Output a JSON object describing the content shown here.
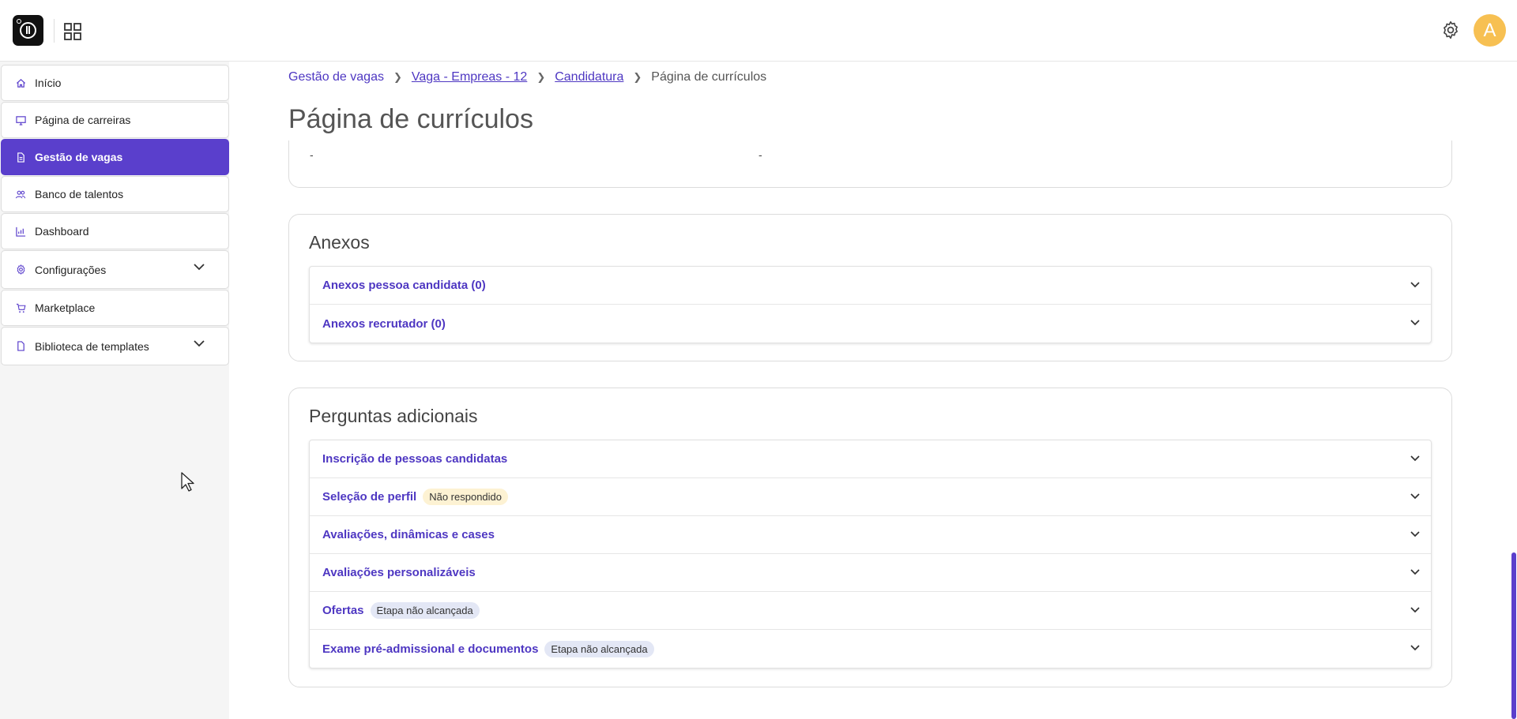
{
  "topbar": {
    "avatar_letter": "A"
  },
  "sidebar": {
    "items": [
      {
        "label": "Início",
        "icon": "home-icon"
      },
      {
        "label": "Página de carreiras",
        "icon": "monitor-icon"
      },
      {
        "label": "Gestão de vagas",
        "icon": "document-icon",
        "active": true
      },
      {
        "label": "Banco de talentos",
        "icon": "people-icon"
      },
      {
        "label": "Dashboard",
        "icon": "chart-icon"
      },
      {
        "label": "Configurações",
        "icon": "gear-icon",
        "expandable": true
      },
      {
        "label": "Marketplace",
        "icon": "cart-icon"
      },
      {
        "label": "Biblioteca de templates",
        "icon": "file-icon",
        "expandable": true
      }
    ]
  },
  "breadcrumb": {
    "items": [
      {
        "label": "Gestão de vagas"
      },
      {
        "label": "Vaga - Empreas - 12"
      },
      {
        "label": "Candidatura"
      }
    ],
    "current": "Página de currículos"
  },
  "page_title": "Página de currículos",
  "top_card": {
    "left_value": "-",
    "right_value": "-"
  },
  "anexos": {
    "title": "Anexos",
    "items": [
      {
        "label": "Anexos pessoa candidata (0)"
      },
      {
        "label": "Anexos recrutador (0)"
      }
    ]
  },
  "perguntas": {
    "title": "Perguntas adicionais",
    "items": [
      {
        "label": "Inscrição de pessoas candidatas",
        "badge": ""
      },
      {
        "label": "Seleção de perfil",
        "badge": "Não respondido"
      },
      {
        "label": "Avaliações, dinâmicas e cases",
        "badge": ""
      },
      {
        "label": "Avaliações personalizáveis",
        "badge": ""
      },
      {
        "label": "Ofertas",
        "badge": "Etapa não alcançada"
      },
      {
        "label": "Exame pré-admissional e documentos",
        "badge": "Etapa não alcançada"
      }
    ]
  },
  "colors": {
    "accent": "#5a3fcc",
    "link": "#4e37c2",
    "avatar": "#f7c052"
  }
}
